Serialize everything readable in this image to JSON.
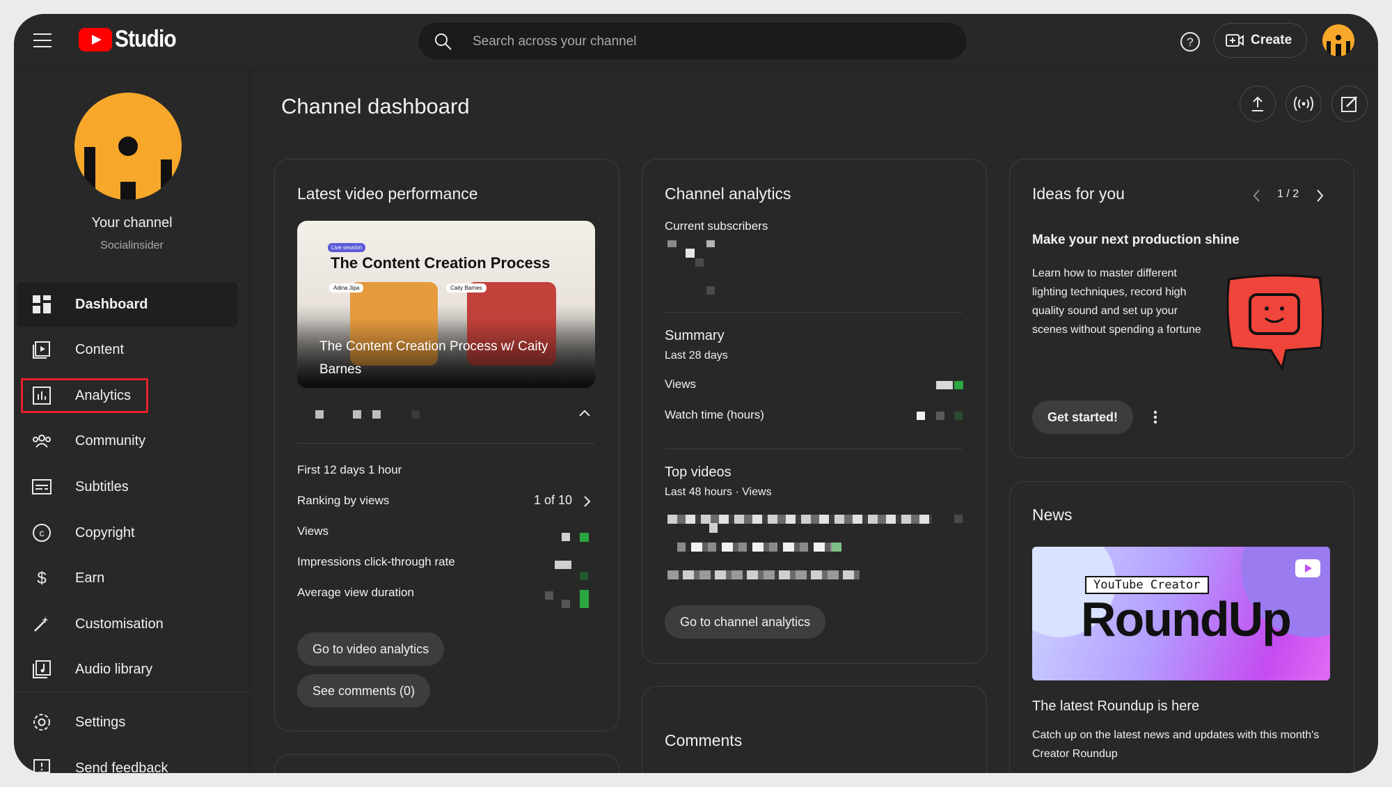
{
  "app": {
    "logo_text": "Studio"
  },
  "search": {
    "placeholder": "Search across your channel"
  },
  "header": {
    "create_label": "Create"
  },
  "sidebar": {
    "your_channel": "Your channel",
    "channel_name": "Socialinsider",
    "items": [
      {
        "label": "Dashboard",
        "icon": "dashboard-icon",
        "active": true
      },
      {
        "label": "Content",
        "icon": "content-icon"
      },
      {
        "label": "Analytics",
        "icon": "analytics-icon"
      },
      {
        "label": "Community",
        "icon": "community-icon"
      },
      {
        "label": "Subtitles",
        "icon": "subtitles-icon"
      },
      {
        "label": "Copyright",
        "icon": "copyright-icon"
      },
      {
        "label": "Earn",
        "icon": "earn-icon"
      },
      {
        "label": "Customisation",
        "icon": "customisation-icon"
      },
      {
        "label": "Audio library",
        "icon": "audio-library-icon"
      }
    ],
    "bottom_items": [
      {
        "label": "Settings",
        "icon": "settings-icon"
      },
      {
        "label": "Send feedback",
        "icon": "feedback-icon"
      }
    ]
  },
  "main": {
    "page_title": "Channel dashboard"
  },
  "latest_video": {
    "title": "Latest video performance",
    "thumbnail": {
      "live_tag": "Live session",
      "heading": "The Content Creation Process",
      "speaker1": "Adina Jipa",
      "speaker2": "Caity Barnes",
      "caption": "The Content Creation Process w/ Caity Barnes"
    },
    "period": "First 12 days 1 hour",
    "ranking_label": "Ranking by views",
    "ranking_value": "1 of 10",
    "metrics": [
      "Views",
      "Impressions click-through rate",
      "Average view duration"
    ],
    "buttons": {
      "analytics": "Go to video analytics",
      "comments": "See comments (0)"
    }
  },
  "channel_analytics": {
    "title": "Channel analytics",
    "subscribers_label": "Current subscribers",
    "summary_title": "Summary",
    "summary_period": "Last 28 days",
    "summary_rows": [
      "Views",
      "Watch time (hours)"
    ],
    "top_videos_title": "Top videos",
    "top_videos_period": "Last 48 hours · Views",
    "button": "Go to channel analytics"
  },
  "ideas": {
    "title": "Ideas for you",
    "pager": "1 / 2",
    "heading": "Make your next production shine",
    "body": "Learn how to master different lighting techniques, record high quality sound and set up your scenes without spending a fortune",
    "cta": "Get started!"
  },
  "news": {
    "title": "News",
    "banner_tag": "YouTube Creator",
    "banner_title": "RoundUp",
    "heading": "The latest Roundup is here",
    "body": "Catch up on the latest news and updates with this month's Creator Roundup"
  },
  "comments": {
    "title": "Comments"
  },
  "colors": {
    "accent_red": "#ff0000",
    "highlight_red": "#e5232c",
    "avatar_orange": "#f7a82b",
    "positive_green": "#2ba640"
  }
}
